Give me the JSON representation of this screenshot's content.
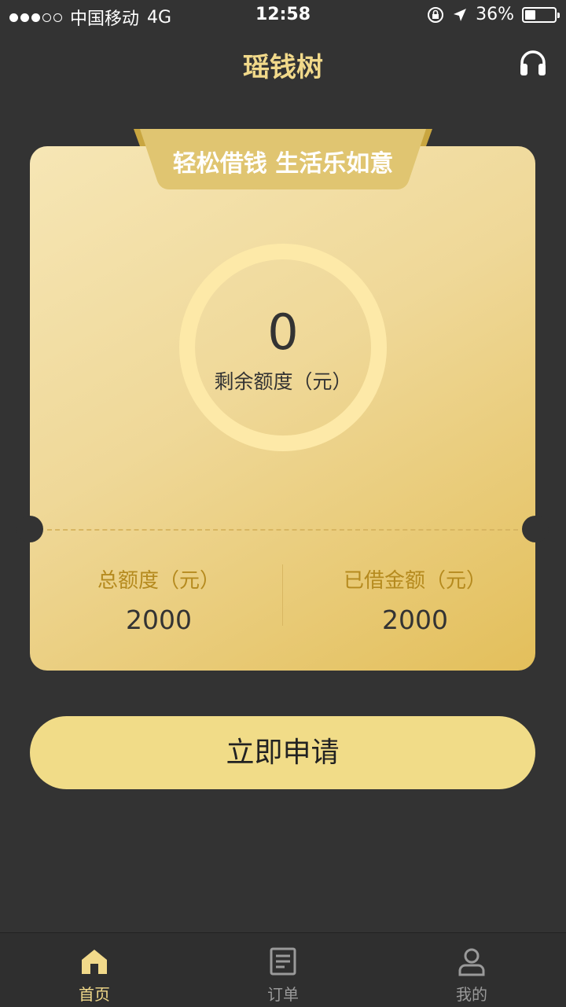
{
  "status_bar": {
    "carrier": "中国移动",
    "network": "4G",
    "time": "12:58",
    "battery_percent": "36%",
    "battery_level": 0.36,
    "signal_dots_filled": 3,
    "signal_dots_total": 5
  },
  "nav": {
    "title": "瑶钱树",
    "support_icon": "headset-icon"
  },
  "card": {
    "ribbon_text": "轻松借钱 生活乐如意",
    "remaining_value": "0",
    "remaining_label": "剩余额度（元）",
    "total_label": "总额度（元）",
    "total_value": "2000",
    "borrowed_label": "已借金额（元）",
    "borrowed_value": "2000"
  },
  "apply_button": {
    "label": "立即申请"
  },
  "tabbar": {
    "items": [
      {
        "label": "首页",
        "icon": "home-icon",
        "active": true
      },
      {
        "label": "订单",
        "icon": "order-icon",
        "active": false
      },
      {
        "label": "我的",
        "icon": "user-icon",
        "active": false
      }
    ]
  },
  "colors": {
    "background": "#333333",
    "accent_gold": "#F1D98A",
    "button": "#F1DC88",
    "ring": "#FDE9A8",
    "stat_label": "#B58A1E"
  }
}
